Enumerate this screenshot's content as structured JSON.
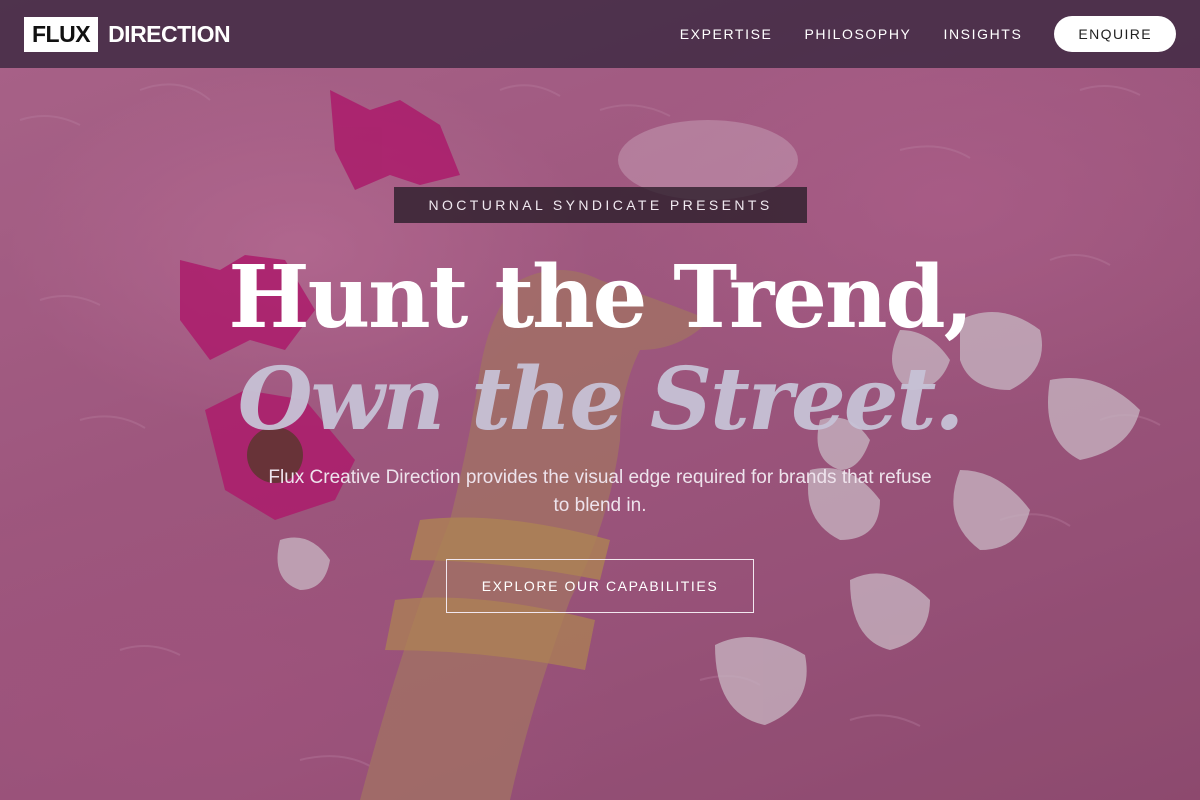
{
  "brand": {
    "logo_box": "FLUX",
    "logo_text": "DIRECTION"
  },
  "nav": {
    "links": [
      "EXPERTISE",
      "PHILOSOPHY",
      "INSIGHTS"
    ],
    "cta": "ENQUIRE"
  },
  "hero": {
    "eyebrow": "NOCTURNAL SYNDICATE PRESENTS",
    "headline_line1": "Hunt the Trend,",
    "headline_line2": "Own the Street.",
    "subtext": "Flux Creative Direction provides the visual edge required for brands that refuse to blend in.",
    "cta": "EXPLORE OUR CAPABILITIES"
  },
  "colors": {
    "nav_bg": "#3c2841",
    "accent_pink": "#c16a95",
    "headline_white": "#ffffff",
    "headline_italic": "#c7c2d6"
  }
}
